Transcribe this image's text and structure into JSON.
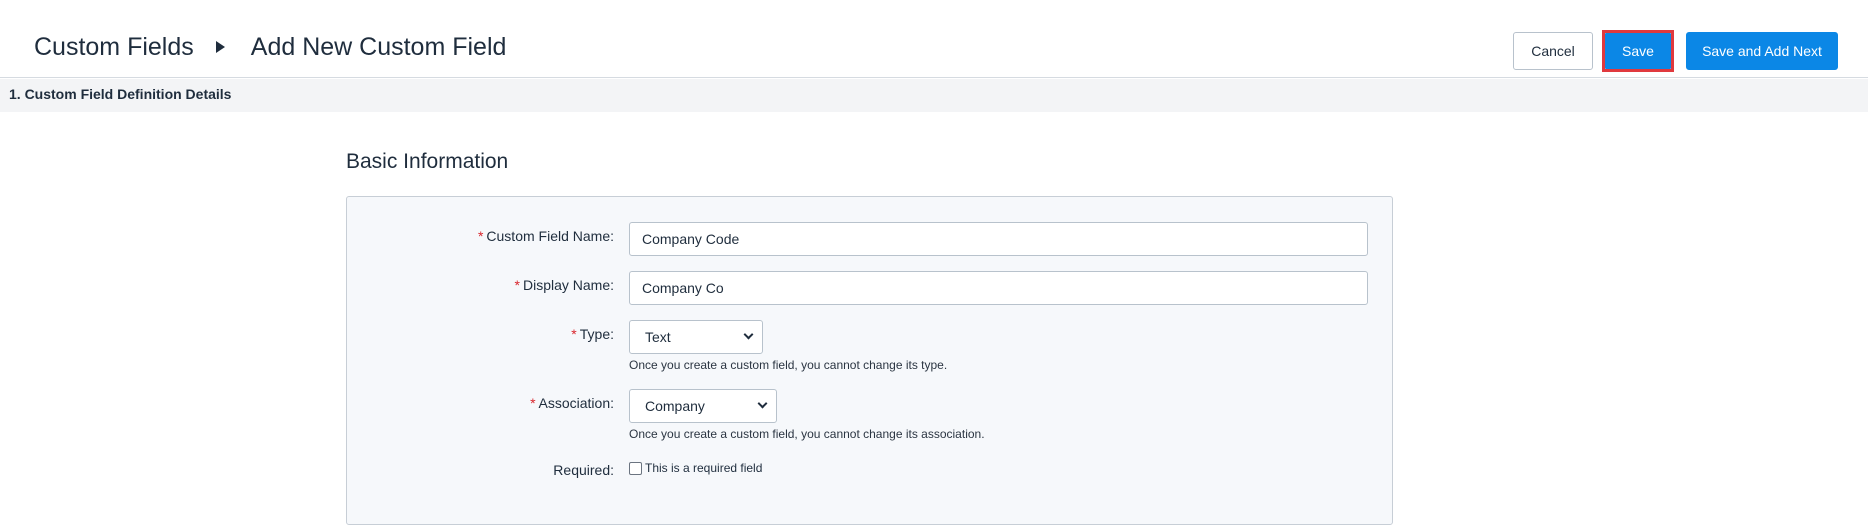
{
  "header": {
    "breadcrumb_root": "Custom Fields",
    "breadcrumb_current": "Add New Custom Field",
    "cancel_label": "Cancel",
    "save_label": "Save",
    "save_and_add_next_label": "Save and Add Next"
  },
  "section": {
    "title": "1. Custom Field Definition Details"
  },
  "basic_info": {
    "title": "Basic Information",
    "fields": {
      "name": {
        "label": "Custom Field Name:",
        "value": "Company Code",
        "required": "*"
      },
      "display_name": {
        "label": "Display Name:",
        "value": "Company Co",
        "required": "*"
      },
      "type": {
        "label": "Type:",
        "value": "Text",
        "required": "*",
        "help": "Once you create a custom field, you cannot change its type."
      },
      "association": {
        "label": "Association:",
        "value": "Company",
        "required": "*",
        "help": "Once you create a custom field, you cannot change its association."
      },
      "required": {
        "label": "Required:",
        "checkbox_label": "This is a required field",
        "checked": false
      }
    }
  },
  "colors": {
    "primary": "#0b87e6",
    "required_asterisk": "#d9262d",
    "highlight_border": "#e0393e"
  }
}
